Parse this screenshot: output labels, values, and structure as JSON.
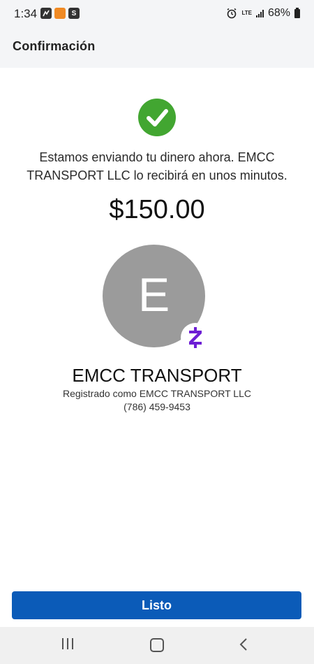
{
  "status_bar": {
    "time": "1:34",
    "network": "LTE",
    "battery": "68%"
  },
  "header": {
    "title": "Confirmación"
  },
  "confirmation": {
    "message": "Estamos enviando tu dinero ahora. EMCC TRANSPORT LLC lo recibirá en unos minutos.",
    "amount": "$150.00"
  },
  "recipient": {
    "initial": "E",
    "name": "EMCC TRANSPORT",
    "registered_as": "Registrado como EMCC TRANSPORT LLC",
    "phone": "(786) 459-9453"
  },
  "actions": {
    "done_label": "Listo"
  },
  "colors": {
    "success": "#42a631",
    "primary_button": "#0b5bb8",
    "zelle_purple": "#6d1ed4",
    "avatar_bg": "#9b9b9b"
  },
  "icons": [
    "check-icon",
    "zelle-icon",
    "alarm-icon",
    "signal-icon",
    "battery-icon",
    "recents-icon",
    "home-icon",
    "back-icon"
  ]
}
